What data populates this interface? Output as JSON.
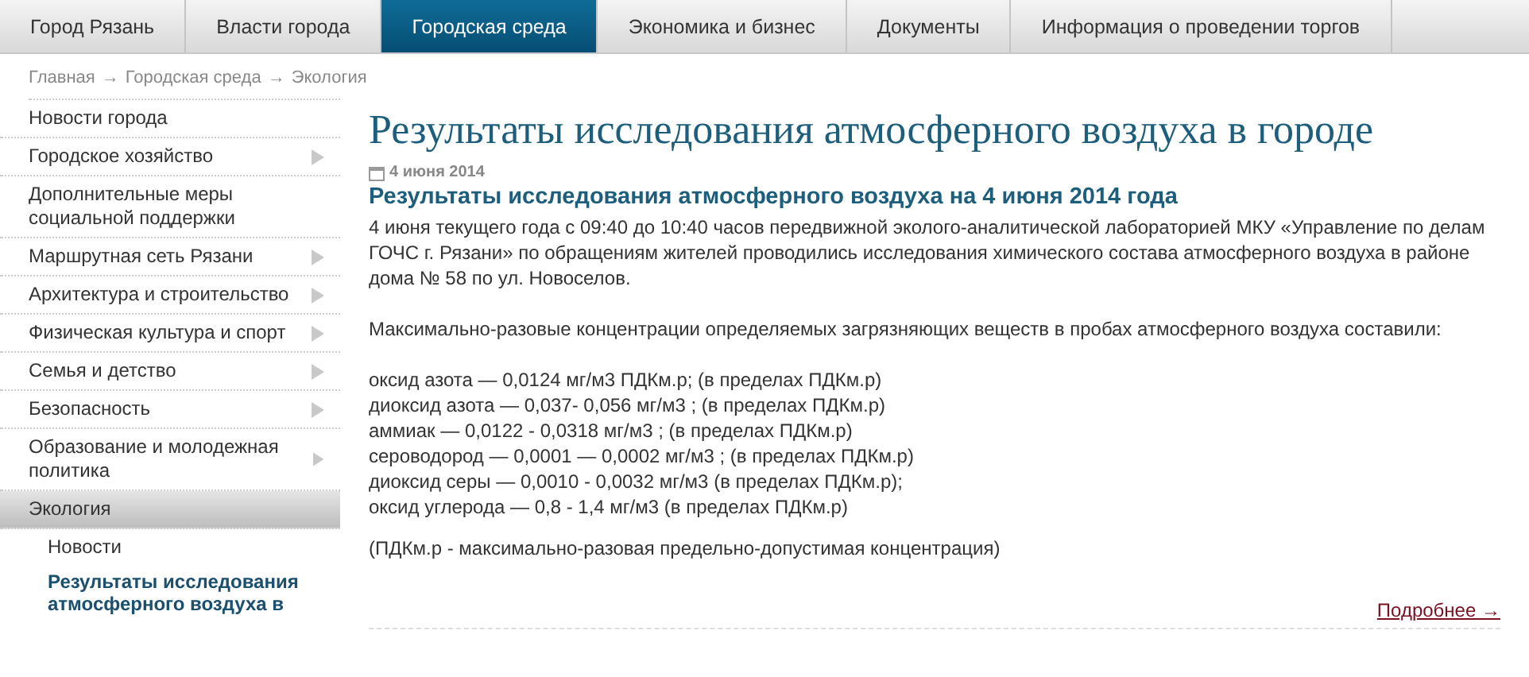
{
  "nav": [
    {
      "label": "Город Рязань",
      "selected": false
    },
    {
      "label": "Власти города",
      "selected": false
    },
    {
      "label": "Городская среда",
      "selected": true
    },
    {
      "label": "Экономика и бизнес",
      "selected": false
    },
    {
      "label": "Документы",
      "selected": false
    },
    {
      "label": "Информация о проведении торгов",
      "selected": false
    }
  ],
  "breadcrumb": [
    "Главная",
    "→",
    "Городская среда",
    "→",
    "Экология"
  ],
  "sidebar": {
    "items": [
      {
        "label": "Новости города",
        "has_submenu": false,
        "selected": false
      },
      {
        "label": "Городское хозяйство",
        "has_submenu": true,
        "selected": false
      },
      {
        "label": "Дополнительные меры социальной поддержки",
        "has_submenu": false,
        "selected": false
      },
      {
        "label": "Маршрутная сеть Рязани",
        "has_submenu": true,
        "selected": false
      },
      {
        "label": "Архитектура и строительство",
        "has_submenu": true,
        "selected": false
      },
      {
        "label": "Физическая культура и спорт",
        "has_submenu": true,
        "selected": false
      },
      {
        "label": "Семья и детство",
        "has_submenu": true,
        "selected": false
      },
      {
        "label": "Безопасность",
        "has_submenu": true,
        "selected": false
      },
      {
        "label": "Образование и молодежная политика",
        "has_submenu": true,
        "selected": false
      },
      {
        "label": "Экология",
        "has_submenu": false,
        "selected": true,
        "children": [
          {
            "label": "Новости",
            "selected": false
          },
          {
            "label": "Результаты исследования атмосферного воздуха в",
            "selected": true
          }
        ]
      }
    ]
  },
  "page_title": "Результаты исследования атмосферного воздуха в городе",
  "article": {
    "date": "4 июня 2014",
    "title": "Результаты исследования атмосферного воздуха на 4 июня 2014 года",
    "blocks": [
      {
        "kind": "paragraph",
        "text": "4 июня текущего года с 09:40 до 10:40 часов передвижной эколого-аналитической лабораторией МКУ «Управление по делам ГОЧС г. Рязани» по обращениям жителей проводились исследования химического состава атмосферного воздуха в районе дома № 58 по ул. Новоселов."
      },
      {
        "kind": "paragraph",
        "text": "Максимально-разовые концентрации определяемых загрязняющих веществ в пробах атмосферного воздуха составили:"
      },
      {
        "kind": "lines",
        "lines": [
          "оксид азота — 0,0124 мг/м3 ПДКм.р; (в пределах ПДКм.р)",
          "диоксид азота — 0,037- 0,056 мг/м3 ; (в пределах ПДКм.р)",
          "аммиак — 0,0122 - 0,0318 мг/м3 ; (в пределах ПДКм.р)",
          "сероводород — 0,0001 — 0,0002 мг/м3 ; (в пределах ПДКм.р)",
          "диоксид серы — 0,0010 - 0,0032 мг/м3 (в пределах ПДКм.р);",
          "оксид углерода — 0,8 - 1,4 мг/м3 (в пределах ПДКм.р)"
        ]
      },
      {
        "kind": "note",
        "text": "(ПДКм.р - максимально-разовая предельно-допустимая концентрация)"
      }
    ],
    "more_link": "Подробнее →"
  }
}
